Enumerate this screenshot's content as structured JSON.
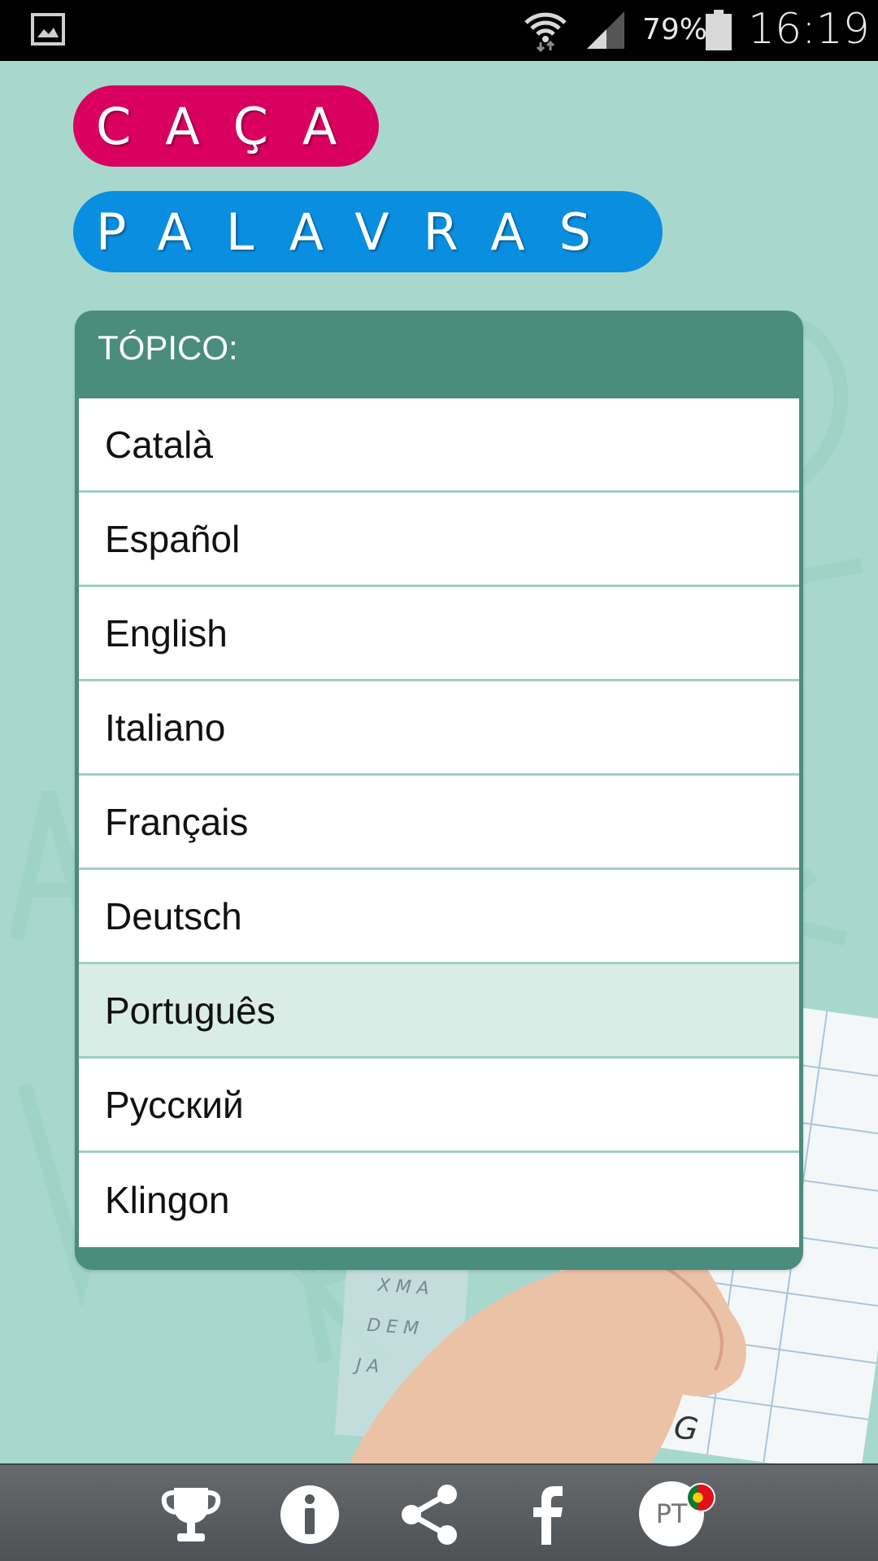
{
  "status_bar": {
    "battery_percent": "79%",
    "time": "16:19"
  },
  "title": {
    "word1": "CAÇA",
    "word2": "PALAVRAS",
    "word1_color": "#d9005f",
    "word2_color": "#0a8ee0"
  },
  "topic_panel": {
    "label": "TÓPICO:",
    "items": [
      {
        "label": "Català"
      },
      {
        "label": "Español"
      },
      {
        "label": "English"
      },
      {
        "label": "Italiano"
      },
      {
        "label": "Français"
      },
      {
        "label": "Deutsch"
      },
      {
        "label": "Português",
        "selected": true
      },
      {
        "label": "Русский"
      },
      {
        "label": "Klingon"
      }
    ]
  },
  "bottom_bar": {
    "icons": [
      "trophy-icon",
      "info-icon",
      "share-icon",
      "facebook-icon",
      "language-icon"
    ],
    "language_code": "PT"
  },
  "colors": {
    "background": "#a8d8cd",
    "panel_header": "#4a8c7e",
    "selected_row": "#d9ede6"
  }
}
